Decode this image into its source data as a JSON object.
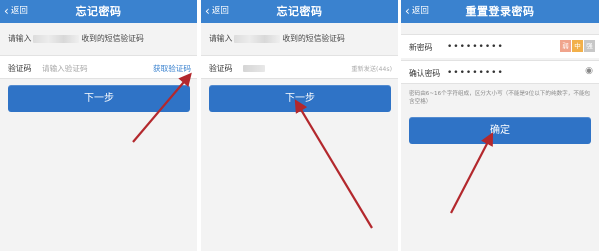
{
  "screens": [
    {
      "back_label": "返回",
      "title": "忘记密码",
      "hint_prefix": "请输入",
      "hint_suffix": "收到的短信验证码",
      "code_label": "验证码",
      "code_placeholder": "请输入验证码",
      "get_code_label": "获取验证码",
      "next_label": "下一步"
    },
    {
      "back_label": "返回",
      "title": "忘记密码",
      "hint_prefix": "请输入",
      "hint_suffix": "收到的短信验证码",
      "code_label": "验证码",
      "resend_label": "重新发送(44s)",
      "next_label": "下一步"
    },
    {
      "back_label": "返回",
      "title": "重置登录密码",
      "new_password_label": "新密码",
      "new_password_value": "•••••••••",
      "strength_levels": [
        "弱",
        "中",
        "强"
      ],
      "confirm_password_label": "确认密码",
      "confirm_password_value": "•••••••••",
      "password_rule": "密码由6~16个字符组成，区分大小写（不能是9位以下的纯数字，不能包含空格）",
      "confirm_label": "确定"
    }
  ],
  "colors": {
    "nav_bar": "#3a82cf",
    "primary_button": "#2f73c6",
    "link": "#3a82cf",
    "arrow": "#b3282d",
    "strength_weak": "#f0a48c",
    "strength_medium": "#f2b04a",
    "strength_strong": "#c7c7c7"
  },
  "icons": [
    "back-chevron-icon",
    "eye-icon",
    "arrow-annotation"
  ]
}
